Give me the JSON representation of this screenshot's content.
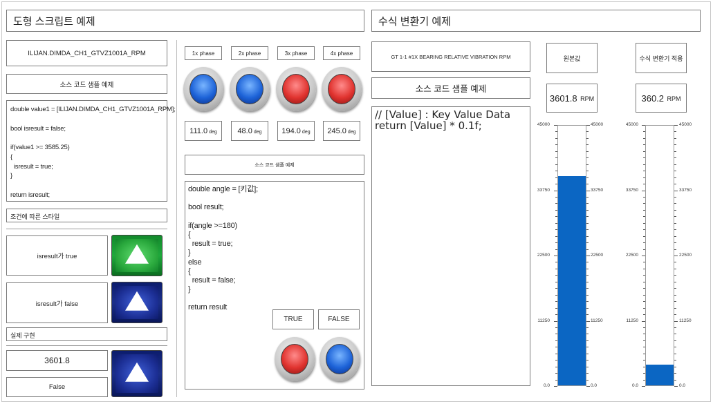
{
  "left_title": "도형 스크립트 예제",
  "right_title": "수식 변환기 예제",
  "tag_name": "ILIJAN.DIMDA_CH1_GTVZ1001A_RPM",
  "source_sample_label": "소스 코드 샘플 예제",
  "code_sample_1": "double value1 = [ILIJAN.DIMDA_CH1_GTVZ1001A_RPM];\n\nbool isresult = false;\n\nif(value1 >= 3585.25)\n{\n  isresult = true;\n}\n\nreturn isresult;",
  "conditional_style_label": "조건에 따른 스타일",
  "cond_true_label": "isresult가 true",
  "cond_false_label": "isresult가 false",
  "actual_impl_label": "실제 구현",
  "actual_value": "3601.8",
  "actual_result": "False",
  "phases": [
    {
      "label": "1x phase",
      "value": "111.0",
      "unit": "deg",
      "color": "blue"
    },
    {
      "label": "2x phase",
      "value": "48.0",
      "unit": "deg",
      "color": "blue"
    },
    {
      "label": "3x phase",
      "value": "194.0",
      "unit": "deg",
      "color": "red"
    },
    {
      "label": "4x phase",
      "value": "245.0",
      "unit": "deg",
      "color": "red"
    }
  ],
  "source_sample_label_small": "소스 코드 샘플 예제",
  "code_sample_2": "double angle = [키값];\n\nbool result;\n\nif(angle >=180)\n{\n  result = true;\n}\nelse\n{\n  result = false;\n}\n\nreturn result",
  "true_label": "TRUE",
  "false_label": "FALSE",
  "formula_tag": "GT 1-1 #1X BEARING RELATIVE VIBRATION RPM",
  "formula_source_label": "소스 코드 샘플 예제",
  "code_sample_3": "// [Value] : Key Value Data\nreturn [Value] * 0.1f;",
  "original_label": "원본값",
  "converted_label": "수식 변환기 적용",
  "original_value": "3601.8",
  "original_unit": "RPM",
  "converted_value": "360.2",
  "converted_unit": "RPM",
  "gauge_ticks": [
    "45000",
    "33750",
    "22500",
    "11250",
    "0.0"
  ],
  "gauge_max": 45000,
  "gauge1_level": 36018,
  "gauge2_level": 3602,
  "colors": {
    "fill": "#0b66c3",
    "lamp_blue": "#1d63d8",
    "lamp_red": "#e0332f",
    "green_button": "#2aa93d",
    "navy_button": "#1c2f95"
  }
}
